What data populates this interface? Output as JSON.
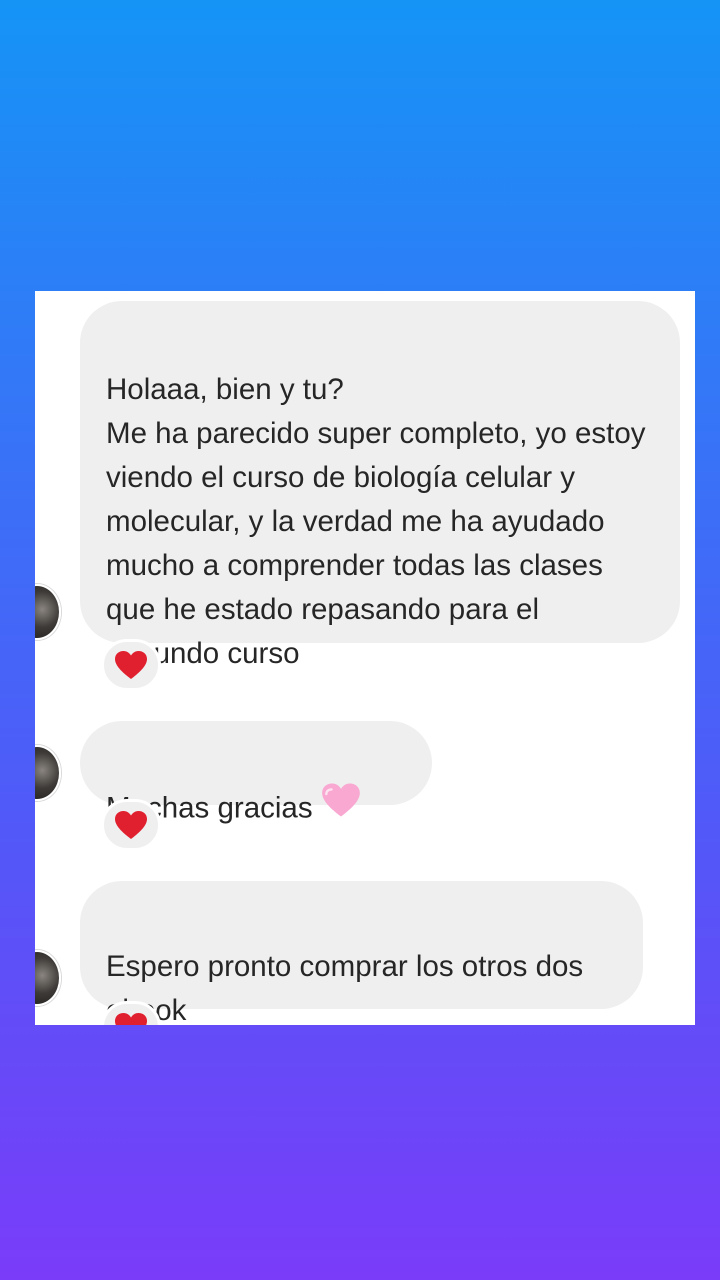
{
  "messages": [
    {
      "text": "Holaaa, bien y tu?\nMe ha parecido super completo, yo estoy viendo el curso de biología celular y molecular, y la verdad me ha ayudado mucho a comprender todas las clases que he estado repasando para el segundo curso",
      "reaction": "red-heart"
    },
    {
      "text": "Muchas gracias",
      "emoji": "pink-heart",
      "reaction": "red-heart"
    },
    {
      "text": "Espero pronto comprar los otros dos ebook",
      "reaction": "red-heart"
    }
  ],
  "colors": {
    "bubble_background": "#efefef",
    "text": "#262626",
    "red_heart": "#e0202f",
    "pink_heart": "#f9a8d2",
    "gradient_top": "#1594f6",
    "gradient_bottom": "#7a3cf9"
  }
}
